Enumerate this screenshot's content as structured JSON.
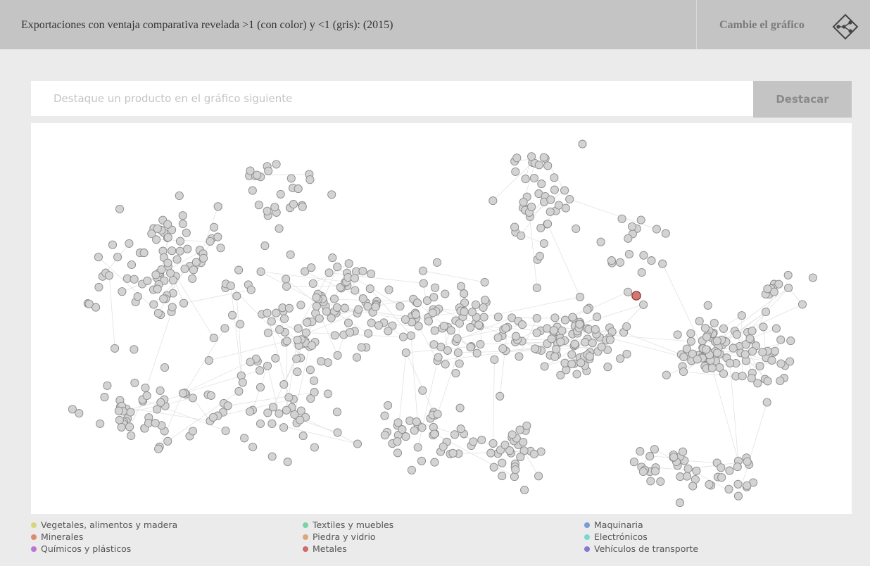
{
  "header": {
    "title": "Exportaciones con ventaja comparativa revelada >1 (con color) y <1 (gris): (2015)",
    "change_chart_label": "Cambie el gráfico"
  },
  "search": {
    "placeholder": "Destaque un producto en el gráfico siguiente",
    "value": "",
    "button_label": "Destacar"
  },
  "colors": {
    "inactive_node": "#d3d3d3",
    "node_stroke": "#8c8c8c",
    "edge": "#e2e2e2",
    "highlighted_node": "#d07873",
    "highlighted_stroke": "#8a2a2a"
  },
  "chart_data": {
    "type": "network",
    "description_of_encoding": "",
    "node_count_estimate": 800,
    "highlighted_category": "Metales",
    "highlighted_nodes": [
      {
        "category": "Metales",
        "value": "RCA > 1"
      }
    ],
    "legend": [
      {
        "label": "Vegetales, alimentos y madera",
        "color": "#d9d47a"
      },
      {
        "label": "Minerales",
        "color": "#d98c73"
      },
      {
        "label": "Químicos y plásticos",
        "color": "#c074d6"
      },
      {
        "label": "Textiles y muebles",
        "color": "#7ad3a4"
      },
      {
        "label": "Piedra y vidrio",
        "color": "#d9a77a"
      },
      {
        "label": "Metales",
        "color": "#d16a6a"
      },
      {
        "label": "Maquinaria",
        "color": "#7a9bd6"
      },
      {
        "label": "Electrónicos",
        "color": "#7ad6d2"
      },
      {
        "label": "Vehículos de transporte",
        "color": "#8a74d6"
      }
    ]
  }
}
